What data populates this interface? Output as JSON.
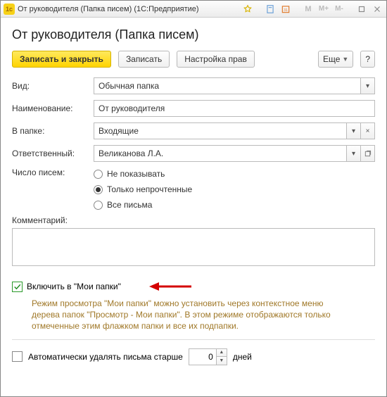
{
  "window": {
    "title": "От руководителя (Папка писем)  (1С:Предприятие)"
  },
  "header": {
    "title": "От руководителя (Папка писем)"
  },
  "toolbar": {
    "save_close": "Записать и закрыть",
    "save": "Записать",
    "rights": "Настройка прав",
    "more": "Еще",
    "help": "?"
  },
  "form": {
    "type_label": "Вид:",
    "type_value": "Обычная папка",
    "name_label": "Наименование:",
    "name_value": "От руководителя",
    "folder_label": "В папке:",
    "folder_value": "Входящие",
    "resp_label": "Ответственный:",
    "resp_value": "Великанова Л.А.",
    "count_label": "Число писем:",
    "count_options": {
      "none": "Не показывать",
      "unread": "Только непрочтенные",
      "all": "Все письма"
    },
    "comment_label": "Комментарий:",
    "comment_value": ""
  },
  "include": {
    "label": "Включить в \"Мои папки\"",
    "hint": "Режим просмотра \"Мои папки\" можно установить через контекстное меню дерева папок \"Просмотр - Мои папки\". В этом режиме отображаются только отмеченные этим флажком папки и все их подпапки."
  },
  "autodelete": {
    "label": "Автоматически удалять письма старше",
    "value": "0",
    "unit": "дней"
  }
}
